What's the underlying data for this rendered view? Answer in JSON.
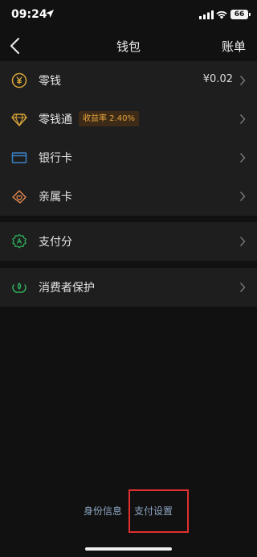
{
  "status_bar": {
    "time": "09:24",
    "battery": "66"
  },
  "nav": {
    "title": "钱包",
    "action": "账单"
  },
  "groups": [
    {
      "items": [
        {
          "label": "零钱",
          "icon": "yen-coin-icon",
          "value": "¥0.02"
        },
        {
          "label": "零钱通",
          "icon": "diamond-icon",
          "badge": "收益率 2.40%"
        },
        {
          "label": "银行卡",
          "icon": "bank-card-icon"
        },
        {
          "label": "亲属卡",
          "icon": "family-card-icon"
        }
      ]
    },
    {
      "items": [
        {
          "label": "支付分",
          "icon": "pay-score-icon"
        }
      ]
    },
    {
      "items": [
        {
          "label": "消费者保护",
          "icon": "consumer-protection-icon"
        }
      ]
    }
  ],
  "bottom_links": {
    "identity": "身份信息",
    "pay_settings": "支付设置"
  },
  "colors": {
    "background": "#111111",
    "card": "#1e1e1e",
    "gold": "#d9a43a",
    "blue": "#3b82c4",
    "orange": "#e58a4e",
    "green": "#2dae5a",
    "link": "#8fa7c4",
    "highlight": "#e03030"
  }
}
